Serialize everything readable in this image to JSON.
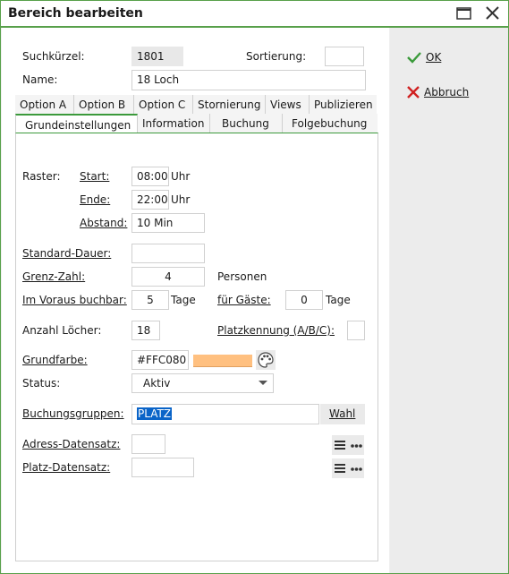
{
  "window": {
    "title": "Bereich bearbeiten"
  },
  "header": {
    "suchkuerzel_label": "Suchkürzel:",
    "suchkuerzel_value": "1801",
    "sortierung_label": "Sortierung:",
    "sortierung_value": "",
    "name_label": "Name:",
    "name_value": "18 Loch"
  },
  "tabs_row1": [
    "Option A",
    "Option B",
    "Option C",
    "Stornierung",
    "Views",
    "Publizieren"
  ],
  "tabs_row2": [
    "Grundeinstellungen",
    "Information",
    "Buchung",
    "Folgebuchung"
  ],
  "form": {
    "raster_label": "Raster:",
    "start_label": "Start:",
    "start_value": "08:00",
    "start_unit": "Uhr",
    "ende_label": "Ende:",
    "ende_value": "22:00",
    "ende_unit": "Uhr",
    "abstand_label": "Abstand:",
    "abstand_value": "10 Min",
    "standard_dauer_label": "Standard-Dauer:",
    "standard_dauer_value": "",
    "grenz_zahl_label": "Grenz-Zahl:",
    "grenz_zahl_value": "4",
    "grenz_zahl_unit": "Personen",
    "voraus_label": "Im Voraus buchbar:",
    "voraus_value": "5",
    "voraus_unit": "Tage",
    "gaeste_label": "für Gäste:",
    "gaeste_value": "0",
    "gaeste_unit": "Tage",
    "loecher_label": "Anzahl Löcher:",
    "loecher_value": "18",
    "platzkennung_label": "Platzkennung (A/B/C):",
    "platzkennung_value": "",
    "grundfarbe_label": "Grundfarbe:",
    "grundfarbe_value": "#FFC080",
    "status_label": "Status:",
    "status_value": "Aktiv",
    "buchungsgruppen_label": "Buchungsgruppen:",
    "buchungsgruppen_value": "PLATZ",
    "wahl_label": "Wahl",
    "adress_label": "Adress-Datensatz:",
    "adress_value": "",
    "platz_label": "Platz-Datensatz:",
    "platz_value": ""
  },
  "side": {
    "ok_label": "OK",
    "abbruch_label": "Abbruch"
  },
  "colors": {
    "accent": "#58a04a",
    "swatch": "#FFC080",
    "selection": "#0a64c8"
  },
  "icons": [
    "maximize-icon",
    "close-icon",
    "checkmark-icon",
    "cross-icon",
    "palette-icon",
    "chevron-down-icon",
    "list-icon",
    "more-icon"
  ]
}
